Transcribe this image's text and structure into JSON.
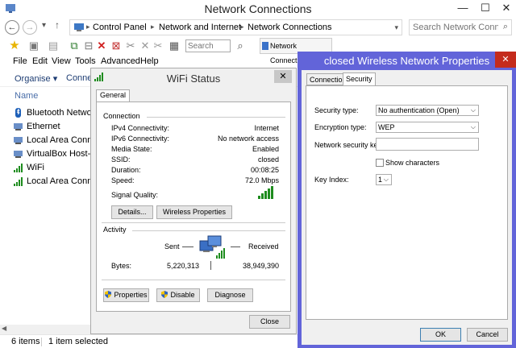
{
  "window": {
    "title": "Network Connections",
    "minimize": "—",
    "maximize": "☐",
    "close": "✕"
  },
  "nav": {
    "back": "←",
    "forward": "→",
    "recent": "▾",
    "up": "↑",
    "breadcrumb": [
      "Control Panel",
      "Network and Internet",
      "Network Connections"
    ],
    "separator": "▸",
    "search_placeholder": "Search Network Conne..."
  },
  "toolbar": {
    "search_placeholder": "Search",
    "tab_label": "Network Connections"
  },
  "menu": [
    "File",
    "Edit",
    "View",
    "Tools",
    "Advanced",
    "Help"
  ],
  "commandbar": {
    "organise": "Organise ▾",
    "connect": "Conne"
  },
  "column_header": "Name",
  "files": [
    {
      "name": "Bluetooth Network",
      "icon": "bluetooth-icon"
    },
    {
      "name": "Ethernet",
      "icon": "network-adapter-icon"
    },
    {
      "name": "Local Area Connec",
      "icon": "network-adapter-icon"
    },
    {
      "name": "VirtualBox Host-Or",
      "icon": "network-adapter-icon"
    },
    {
      "name": "WiFi",
      "icon": "wifi-signal-icon"
    },
    {
      "name": "Local Area Connec",
      "icon": "wifi-signal-icon"
    }
  ],
  "status": {
    "items": "6 items",
    "selected": "1 item selected"
  },
  "wifi_status": {
    "title": "WiFi Status",
    "close": "✕",
    "tab": "General",
    "connection_heading": "Connection",
    "rows": [
      {
        "label": "IPv4 Connectivity:",
        "value": "Internet"
      },
      {
        "label": "IPv6 Connectivity:",
        "value": "No network access"
      },
      {
        "label": "Media State:",
        "value": "Enabled"
      },
      {
        "label": "SSID:",
        "value": "closed"
      },
      {
        "label": "Duration:",
        "value": "00:08:25"
      },
      {
        "label": "Speed:",
        "value": "72.0 Mbps"
      }
    ],
    "signal_label": "Signal Quality:",
    "signal_bars": 5,
    "details_button": "Details...",
    "wireless_props_button": "Wireless Properties",
    "activity_heading": "Activity",
    "sent_label": "Sent",
    "received_label": "Received",
    "bytes_label": "Bytes:",
    "bytes_sent": "5,220,313",
    "bytes_received": "38,949,390",
    "properties_button": "Properties",
    "disable_button": "Disable",
    "diagnose_button": "Diagnose",
    "close_button": "Close"
  },
  "props": {
    "title": "closed Wireless Network Properties",
    "close": "✕",
    "tabs": [
      "Connection",
      "Security"
    ],
    "active_tab": "Security",
    "security_type_label": "Security type:",
    "security_type_value": "No authentication (Open)",
    "encryption_type_label": "Encryption type:",
    "encryption_type_value": "WEP",
    "network_key_label": "Network security key",
    "network_key_value": "",
    "show_characters_label": "Show characters",
    "key_index_label": "Key Index:",
    "key_index_value": "1",
    "ok_button": "OK",
    "cancel_button": "Cancel"
  },
  "colors": {
    "props_frame": "#6264d9",
    "close_red": "#c42b1c",
    "signal_green": "#1e8c1e"
  }
}
